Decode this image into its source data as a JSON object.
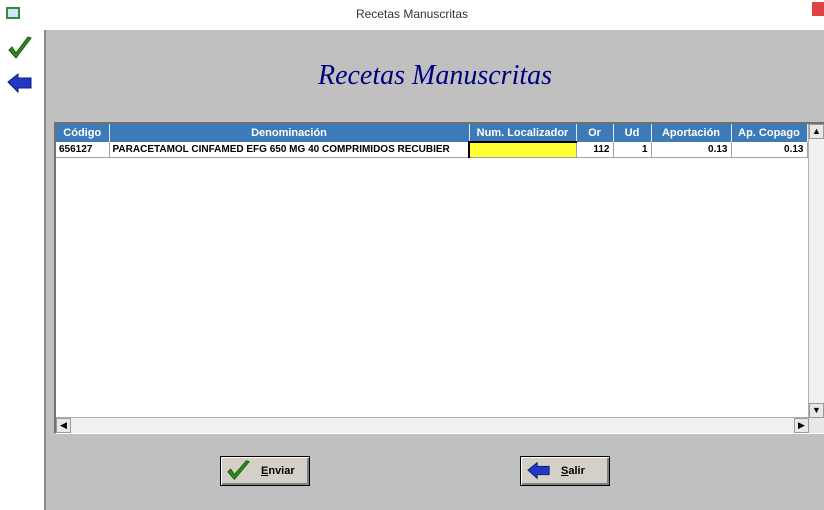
{
  "window": {
    "title": "Recetas Manuscritas"
  },
  "form": {
    "heading": "Recetas Manuscritas"
  },
  "table": {
    "columns": [
      "Código",
      "Denominación",
      "Num. Localizador",
      "Or",
      "Ud",
      "Aportación",
      "Ap. Copago"
    ],
    "rows": [
      {
        "codigo": "656127",
        "denominacion": "PARACETAMOL CINFAMED EFG 650 MG 40 COMPRIMIDOS RECUBIER",
        "localizador": "",
        "or": "112",
        "ud": "1",
        "aportacion": "0.13",
        "copago": "0.13"
      }
    ]
  },
  "buttons": {
    "send_label": "Enviar",
    "exit_label": "Salir"
  },
  "colors": {
    "header": "#3d7ab8",
    "panel": "#c0c0c0",
    "title": "#000080",
    "highlight": "#ffff33"
  },
  "icons": {
    "send": "checkmark-icon",
    "exit": "back-arrow-icon"
  }
}
